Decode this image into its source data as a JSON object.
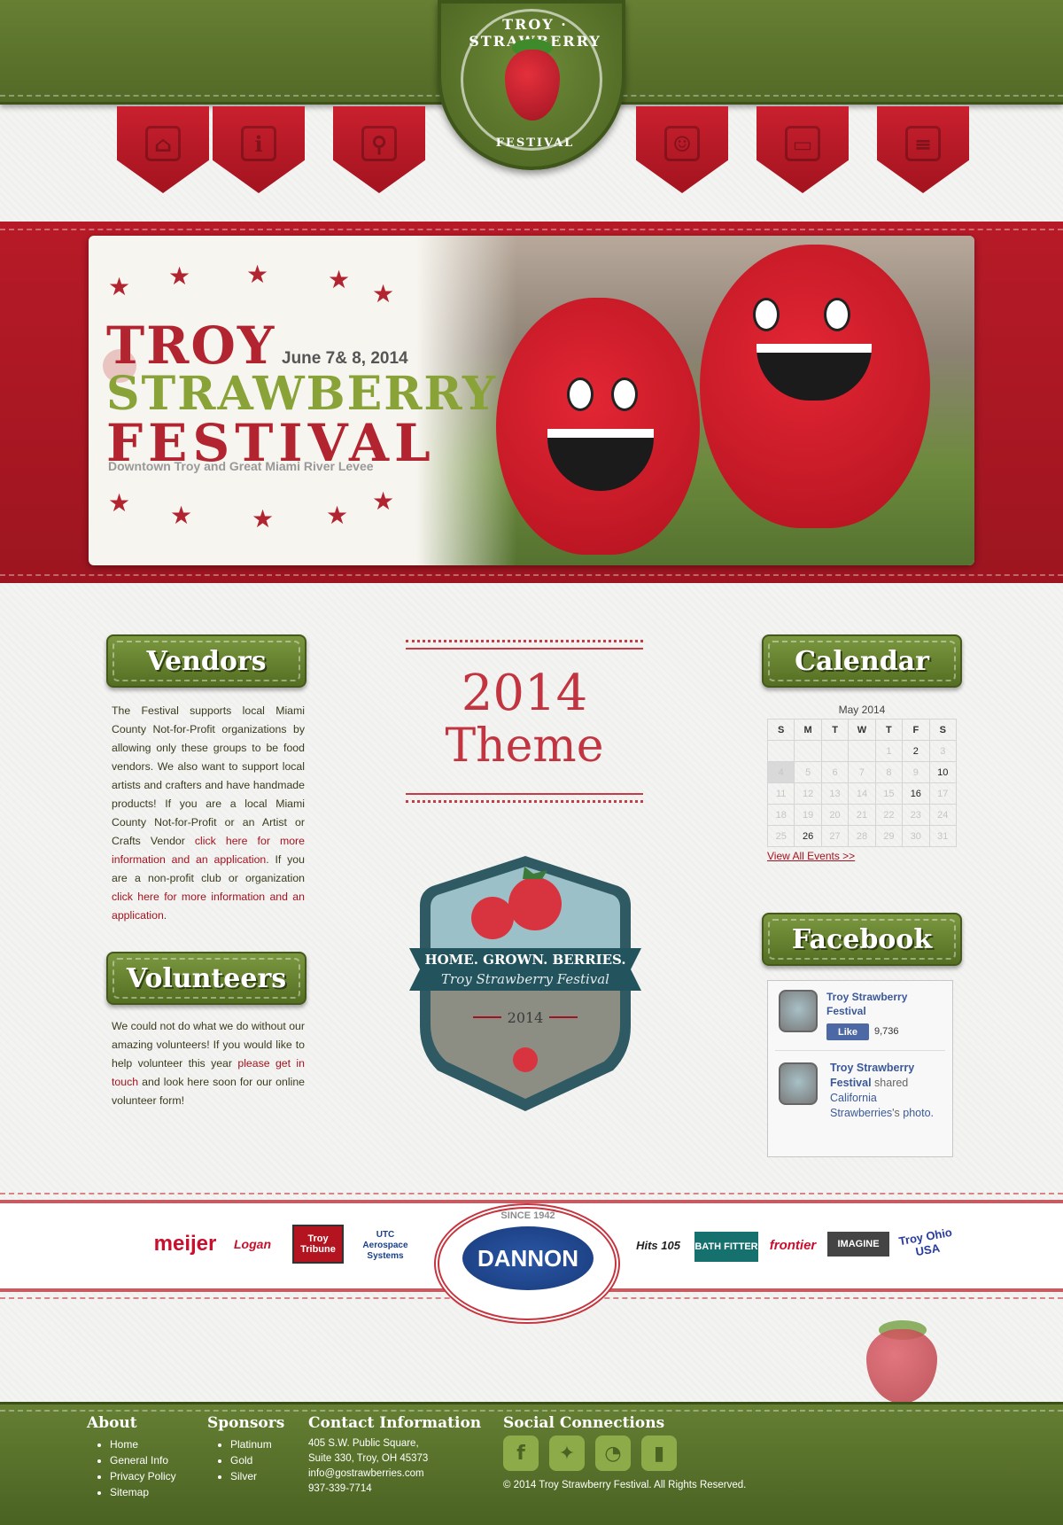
{
  "header": {
    "logo_arc_top": "TROY · STRAWBERRY",
    "logo_arc_bottom": "FESTIVAL",
    "nav": [
      {
        "name": "home",
        "icon": "home-icon",
        "glyph": "⌂"
      },
      {
        "name": "info",
        "icon": "info-icon",
        "glyph": "i"
      },
      {
        "name": "search",
        "icon": "search-icon",
        "glyph": "⚲"
      },
      {
        "name": "contact",
        "icon": "contact-card-icon",
        "glyph": "☺"
      },
      {
        "name": "media",
        "icon": "monitor-icon",
        "glyph": "▭"
      },
      {
        "name": "document",
        "icon": "document-icon",
        "glyph": "≡"
      }
    ]
  },
  "banner": {
    "title_line1": "TROY",
    "title_line2": "STRAWBERRY",
    "title_line3": "FESTIVAL",
    "date": "June 7& 8, 2014",
    "location": "Downtown Troy and Great Miami River Levee"
  },
  "vendors": {
    "heading": "Vendors",
    "text1": "The Festival supports local Miami County Not-for-Profit organizations by allowing only these groups to be food vendors. We also want to support local artists and crafters and have handmade products! If you are a local Miami County Not-for-Profit or an Artist or Crafts Vendor ",
    "link1": "click here for more information and an application",
    "text2": ". If you are a non-profit club or organization ",
    "link2": "click here for more information and an application",
    "text3": "."
  },
  "volunteers": {
    "heading": "Volunteers",
    "text1": "We could not do what we do without our amazing volunteers! If you would like to help volunteer this year ",
    "link1": "please get in touch",
    "text2": " and look here soon for our online volunteer form!"
  },
  "theme": {
    "year": "2014",
    "label": "Theme",
    "emblem_banner": "HOME. GROWN. BERRIES.",
    "emblem_script": "Troy Strawberry Festival",
    "emblem_year": "2014"
  },
  "calendar": {
    "heading": "Calendar",
    "month_label": "May  2014",
    "weekdays": [
      "S",
      "M",
      "T",
      "W",
      "T",
      "F",
      "S"
    ],
    "weeks": [
      [
        "",
        "",
        "",
        "",
        "1",
        "2",
        "3"
      ],
      [
        "4",
        "5",
        "6",
        "7",
        "8",
        "9",
        "10"
      ],
      [
        "11",
        "12",
        "13",
        "14",
        "15",
        "16",
        "17"
      ],
      [
        "18",
        "19",
        "20",
        "21",
        "22",
        "23",
        "24"
      ],
      [
        "25",
        "26",
        "27",
        "28",
        "29",
        "30",
        "31"
      ]
    ],
    "event_days": [
      "2",
      "10",
      "16",
      "26"
    ],
    "today": "4",
    "view_all": "View All Events >>"
  },
  "facebook": {
    "heading": "Facebook",
    "page_name": "Troy Strawberry Festival",
    "like_label": "Like",
    "like_count": "9,736",
    "post_author": "Troy Strawberry Festival",
    "post_action": " shared ",
    "post_link": "California Strawberries",
    "post_suffix": "'s ",
    "post_photo": "photo."
  },
  "sponsors": {
    "items": [
      "meijer",
      "Logan",
      "Troy Tribune",
      "UTC Aerospace Systems",
      "Hits 105",
      "BATH FITTER",
      "frontier",
      "IMAGINE",
      "Troy Ohio USA"
    ],
    "feature": "DANNON",
    "feature_since": "SINCE 1942"
  },
  "footer": {
    "about_heading": "About",
    "about_links": [
      "Home",
      "General Info",
      "Privacy Policy",
      "Sitemap"
    ],
    "sponsors_heading": "Sponsors",
    "sponsor_links": [
      "Platinum",
      "Gold",
      "Silver"
    ],
    "contact_heading": "Contact Information",
    "address1": "405 S.W. Public Square,",
    "address2": "Suite 330, Troy, OH 45373",
    "email": "info@gostrawberries.com",
    "phone": "937-339-7714",
    "social_heading": "Social Connections",
    "social": [
      {
        "name": "facebook-icon",
        "glyph": "f"
      },
      {
        "name": "twitter-icon",
        "glyph": "✦"
      },
      {
        "name": "rss-icon",
        "glyph": "◔"
      },
      {
        "name": "bookmark-icon",
        "glyph": "▮"
      }
    ],
    "copyright": "© 2014 Troy Strawberry Festival. All Rights Reserved."
  },
  "colors": {
    "green": "#5a7329",
    "red": "#b71a27",
    "link": "#a3131f",
    "facebook_blue": "#3b5998"
  }
}
